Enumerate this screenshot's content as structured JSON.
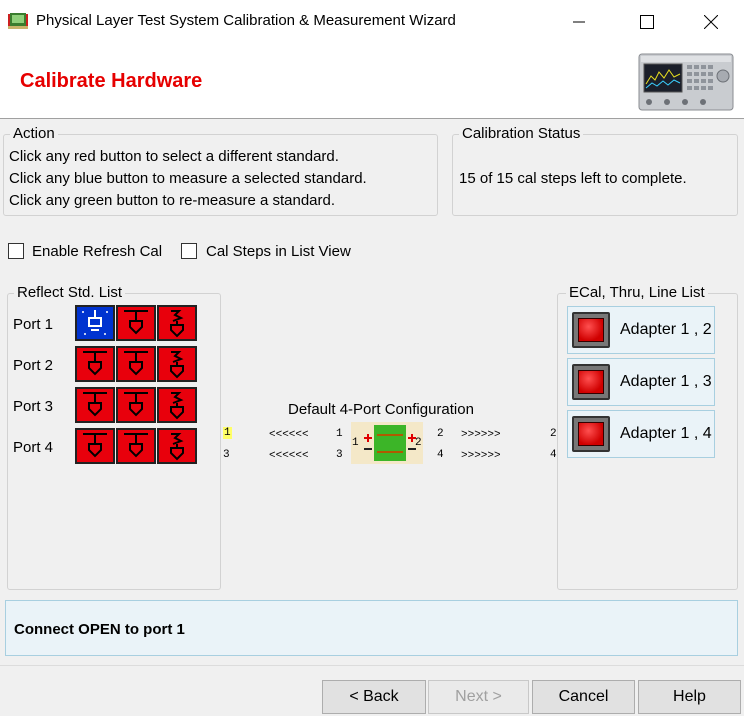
{
  "window": {
    "title": "Physical Layer Test System Calibration & Measurement Wizard",
    "controls": [
      "minimize",
      "maximize",
      "close"
    ]
  },
  "header": {
    "title": "Calibrate Hardware",
    "title_color": "#e60000"
  },
  "action": {
    "legend": "Action",
    "lines": [
      "Click any red button to select a different standard.",
      "Click any blue button to measure a selected standard.",
      "Click any green button to re-measure a standard."
    ]
  },
  "calibration_status": {
    "legend": "Calibration Status",
    "text": "15 of 15 cal steps left to complete."
  },
  "options": {
    "enable_refresh_cal": {
      "label": "Enable Refresh Cal",
      "checked": false
    },
    "cal_steps_list_view": {
      "label": "Cal Steps in List View",
      "checked": false
    }
  },
  "reflect_list": {
    "legend": "Reflect Std. List",
    "ports": [
      {
        "label": "Port 1",
        "buttons": [
          "blue",
          "red",
          "red"
        ]
      },
      {
        "label": "Port 2",
        "buttons": [
          "red",
          "red",
          "red"
        ]
      },
      {
        "label": "Port 3",
        "buttons": [
          "red",
          "red",
          "red"
        ]
      },
      {
        "label": "Port 4",
        "buttons": [
          "red",
          "red",
          "red"
        ]
      }
    ]
  },
  "configuration": {
    "title": "Default 4-Port Configuration",
    "row1": {
      "left_port": "1",
      "arrows_left": "<<<<<<",
      "near_left": "1",
      "fixture_left": "1",
      "fixture_right": "2",
      "near_right": "2",
      "arrows_right": ">>>>>>",
      "right_port": "2"
    },
    "row2": {
      "left_port": "3",
      "arrows_left": "<<<<<<",
      "near_left": "3",
      "near_right": "4",
      "arrows_right": ">>>>>>",
      "right_port": "4"
    },
    "highlight_color": "#ffff66"
  },
  "thru_list": {
    "legend": "ECal, Thru, Line List",
    "items": [
      {
        "label": "Adapter 1 , 2"
      },
      {
        "label": "Adapter 1 , 3"
      },
      {
        "label": "Adapter 1 , 4"
      }
    ]
  },
  "status_message": "Connect OPEN to port 1",
  "buttons": {
    "back": "< Back",
    "next": "Next >",
    "cancel": "Cancel",
    "help": "Help"
  },
  "colors": {
    "red_standard": "#e8000c",
    "blue_standard": "#0033d0",
    "fixture_green": "#3cb528"
  }
}
